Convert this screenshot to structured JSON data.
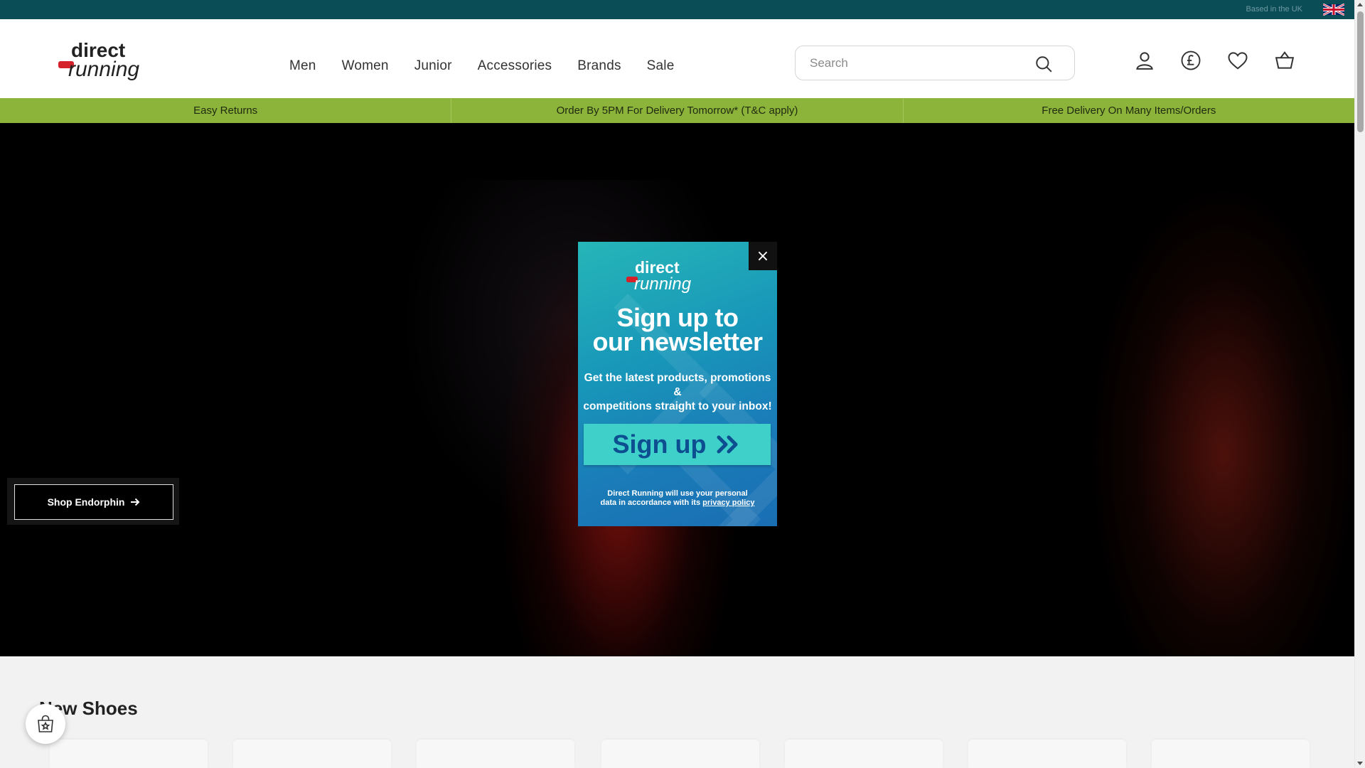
{
  "topbar": {
    "based_text": "Based in the UK"
  },
  "header": {
    "logo_top": "direct",
    "logo_bottom": "running",
    "nav": [
      "Men",
      "Women",
      "Junior",
      "Accessories",
      "Brands",
      "Sale"
    ],
    "search_placeholder": "Search"
  },
  "usp": [
    "Easy Returns",
    "Order By 5PM For Delivery Tomorrow* (T&C apply)",
    "Free Delivery On Many Items/Orders"
  ],
  "hero": {
    "cta_label": "Shop Endorphin"
  },
  "section": {
    "title": "New Shoes"
  },
  "popup": {
    "logo_top": "direct",
    "logo_bottom": "running",
    "headline_1": "Sign up to",
    "headline_2": "our newsletter",
    "sub_1": "Get the latest products, promotions &",
    "sub_2": "competitions straight to your inbox!",
    "signup_label": "Sign up",
    "legal_1": "Direct Running will use your personal",
    "legal_2": "data in accordance with its",
    "legal_link": "privacy policy",
    "close_label": "×"
  },
  "colors": {
    "topbar": "#0b4d57",
    "usp": "#8cb33a",
    "logo_red": "#d4212a",
    "popup_button": "#3ed0c9"
  }
}
